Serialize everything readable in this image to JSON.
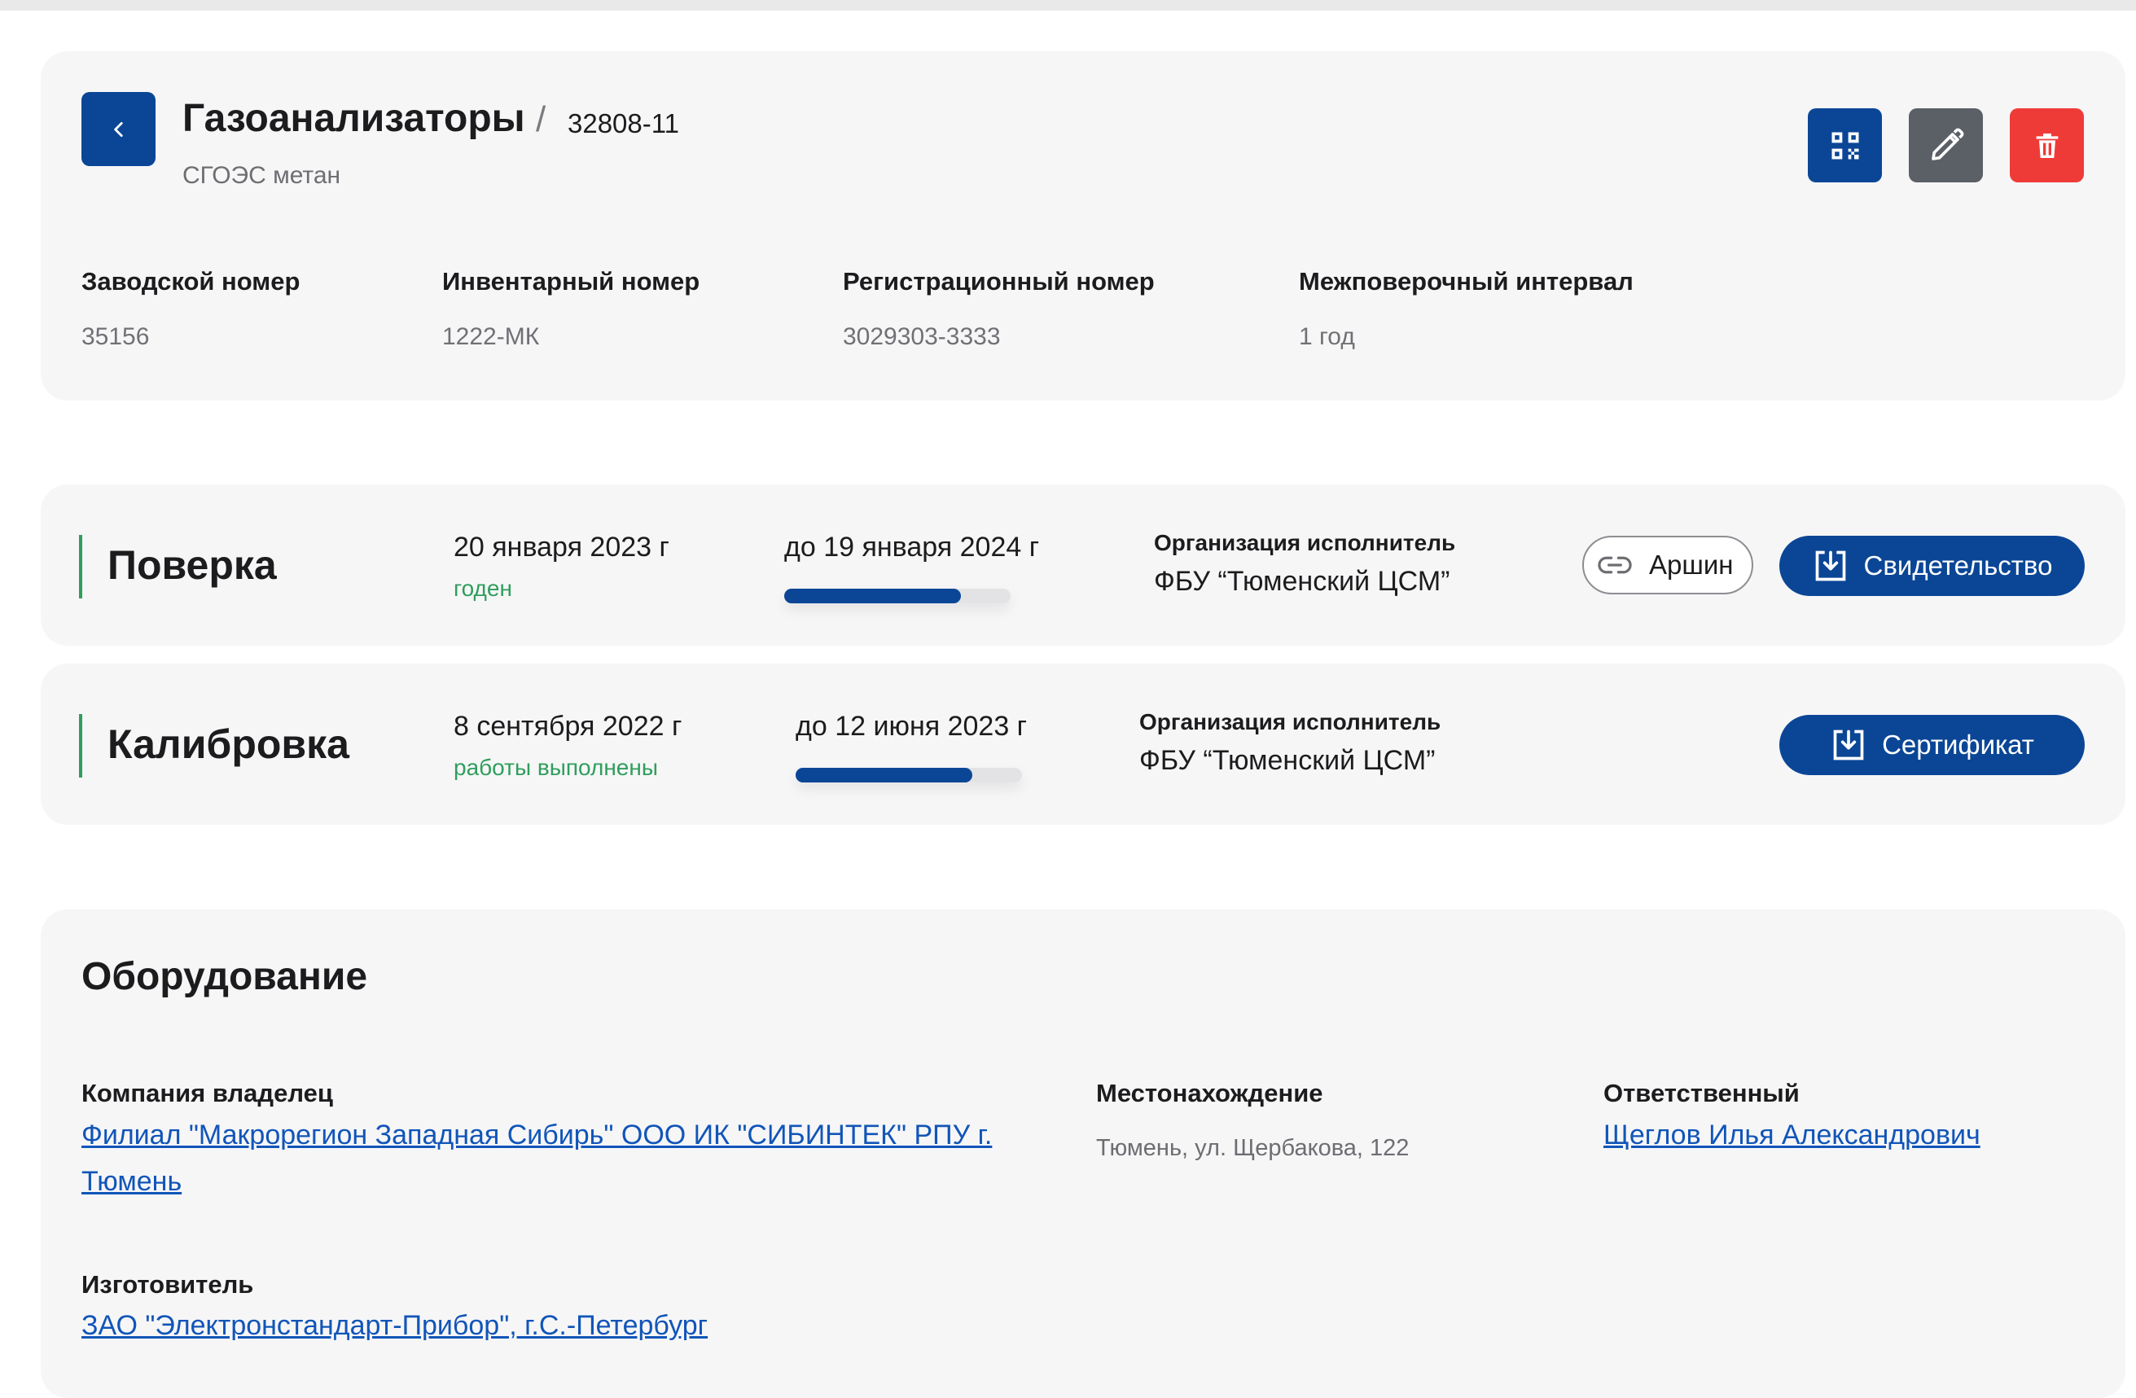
{
  "header": {
    "title": "Газоанализаторы",
    "separator": "/",
    "number": "32808-11",
    "subtitle": "СГОЭС метан",
    "fields": [
      {
        "label": "Заводской номер",
        "value": "35156"
      },
      {
        "label": "Инвентарный номер",
        "value": "1222-МК"
      },
      {
        "label": "Регистрационный номер",
        "value": "3029303-3333"
      },
      {
        "label": "Межповерочный интервал",
        "value": "1 год"
      }
    ],
    "icons": {
      "back": "chevron-left-icon",
      "qr": "qr-code-icon",
      "edit": "pencil-icon",
      "delete": "trash-icon"
    },
    "colors": {
      "primary": "#0b4696",
      "edit": "#5b5f66",
      "danger": "#ef3b38"
    }
  },
  "verification": {
    "title": "Поверка",
    "date": "20 января 2023 г",
    "state": "годен",
    "due": "до 19 января 2024 г",
    "progress": 0.78,
    "org_label": "Организация исполнитель",
    "org_value": "ФБУ “Тюменский ЦСМ”",
    "link_label": "Аршин",
    "button_label": "Свидетельство"
  },
  "calibration": {
    "title": "Калибровка",
    "date": "8 сентября 2022 г",
    "state": "работы выполнены",
    "due": "до 12 июня 2023 г",
    "progress": 0.78,
    "org_label": "Организация исполнитель",
    "org_value": "ФБУ “Тюменский ЦСМ”",
    "button_label": "Сертификат"
  },
  "equipment": {
    "title": "Оборудование",
    "owner_label": "Компания владелец",
    "owner_value": "Филиал \"Макрорегион Западная Сибирь\" ООО ИК \"СИБИНТЕК\" РПУ г. Тюмень",
    "location_label": "Местонахождение",
    "location_value": "Тюмень, ул. Щербакова, 122",
    "responsible_label": "Ответственный",
    "responsible_value": "Щеглов Илья Александрович",
    "manufacturer_label": "Изготовитель",
    "manufacturer_value": "ЗАО \"Электронстандарт-Прибор\", г.С.-Петербург"
  },
  "status_color": "#2f9e5c",
  "link_color": "#1155b8"
}
